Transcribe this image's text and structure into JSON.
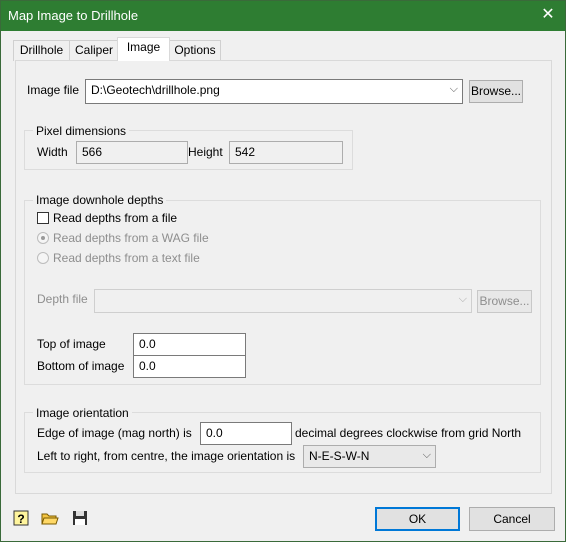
{
  "window": {
    "title": "Map Image to Drillhole",
    "close_glyph": "✕"
  },
  "tabs": [
    {
      "label": "Drillhole",
      "active": false
    },
    {
      "label": "Caliper",
      "active": false
    },
    {
      "label": "Image",
      "active": true
    },
    {
      "label": "Options",
      "active": false
    }
  ],
  "image_file": {
    "label": "Image file",
    "value": "D:\\Geotech\\drillhole.png",
    "browse_label": "Browse..."
  },
  "pixel_dimensions": {
    "legend": "Pixel dimensions",
    "width_label": "Width",
    "width_value": "566",
    "height_label": "Height",
    "height_value": "542"
  },
  "downhole": {
    "legend": "Image downhole depths",
    "read_from_file_label": "Read depths from a file",
    "read_from_file_checked": false,
    "wag_label": "Read depths from a WAG file",
    "text_label": "Read depths from a text file",
    "depth_file_label": "Depth file",
    "depth_file_value": "",
    "browse_label": "Browse...",
    "top_label": "Top of image",
    "top_value": "0.0",
    "bottom_label": "Bottom of image",
    "bottom_value": "0.0"
  },
  "orientation": {
    "legend": "Image orientation",
    "edge_label": "Edge of image (mag north) is",
    "edge_value": "0.0",
    "edge_suffix": "decimal degrees clockwise from grid North",
    "lr_label": "Left to right, from centre, the image orientation is",
    "lr_value": "N-E-S-W-N"
  },
  "footer": {
    "ok_label": "OK",
    "cancel_label": "Cancel"
  },
  "icons": {
    "help": "help-icon",
    "open": "open-folder-icon",
    "save": "save-icon"
  },
  "colors": {
    "titlebar": "#2e7d32",
    "default_button_border": "#0078d7"
  }
}
